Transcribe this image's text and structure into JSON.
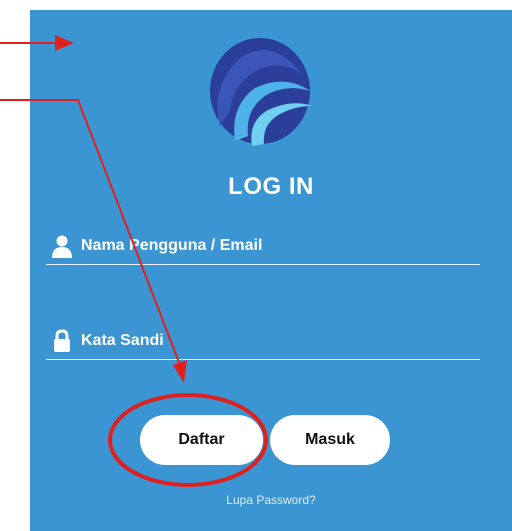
{
  "screen": {
    "title": "LOG IN",
    "username_field": {
      "placeholder": "Nama Pengguna / Email",
      "icon": "user-icon"
    },
    "password_field": {
      "placeholder": "Kata Sandi",
      "icon": "lock-icon"
    },
    "buttons": {
      "register_label": "Daftar",
      "login_label": "Masuk"
    },
    "forgot_password_label": "Lupa Password?",
    "logo": "kominfo-logo"
  },
  "colors": {
    "background": "#3a95d2",
    "button": "#ffffff",
    "annotation": "#e0201f"
  }
}
